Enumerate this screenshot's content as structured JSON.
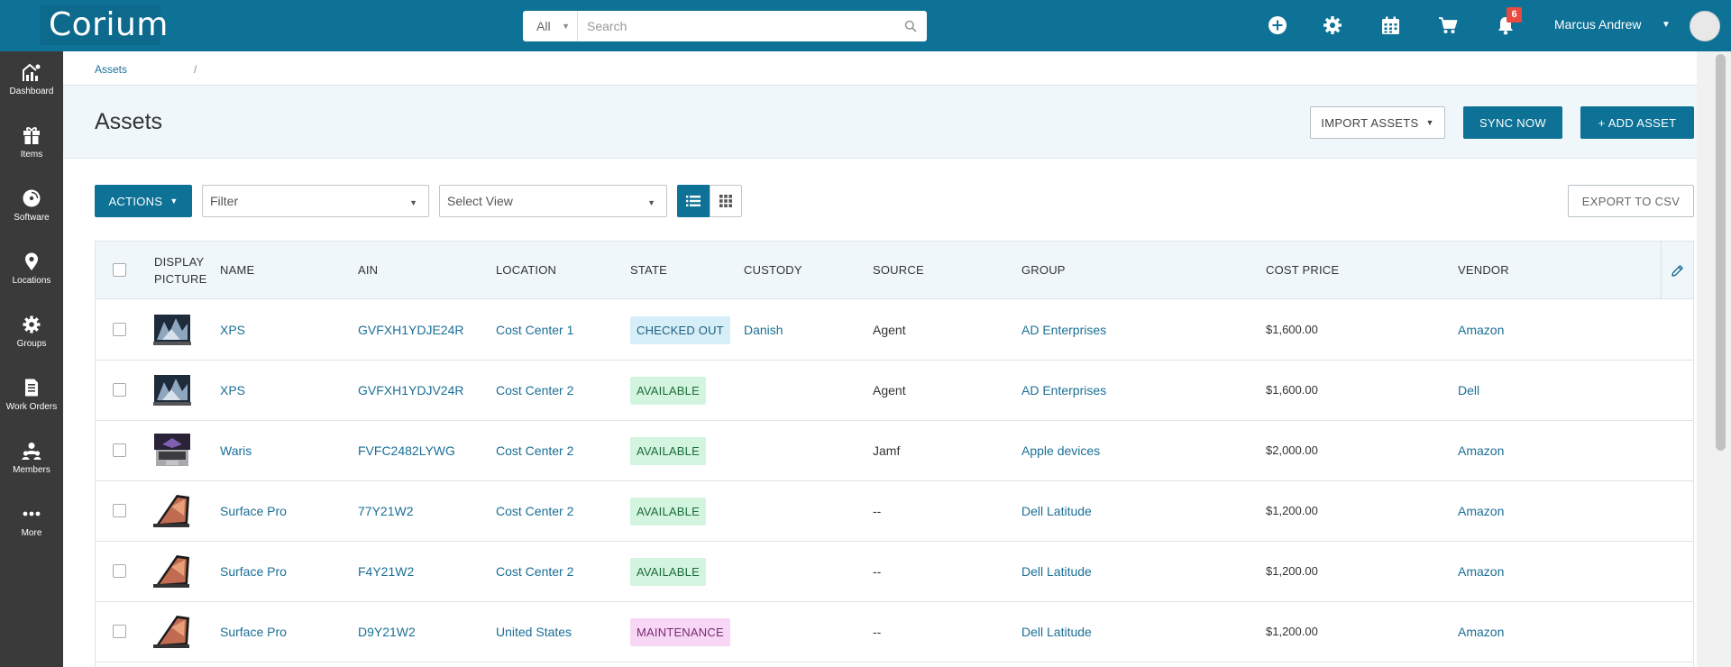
{
  "brand": {
    "logo": "Corium"
  },
  "search": {
    "scope": "All",
    "placeholder": "Search"
  },
  "header": {
    "notification_count": "6",
    "user_name": "Marcus Andrew"
  },
  "sidebar": {
    "items": [
      {
        "label": "Dashboard",
        "icon": "dashboard-icon"
      },
      {
        "label": "Items",
        "icon": "items-icon"
      },
      {
        "label": "Software",
        "icon": "software-icon"
      },
      {
        "label": "Locations",
        "icon": "location-pin-icon"
      },
      {
        "label": "Groups",
        "icon": "groups-icon"
      },
      {
        "label": "Work Orders",
        "icon": "work-orders-icon"
      },
      {
        "label": "Members",
        "icon": "members-icon"
      },
      {
        "label": "More",
        "icon": "more-icon"
      }
    ]
  },
  "breadcrumb": {
    "item": "Assets",
    "sep": "/"
  },
  "page": {
    "title": "Assets",
    "import_label": "IMPORT ASSETS",
    "sync_label": "SYNC NOW",
    "add_label": "+ ADD ASSET"
  },
  "toolbar": {
    "actions_label": "ACTIONS",
    "filter_value": "Filter",
    "view_value": "Select View",
    "export_label": "EXPORT TO CSV"
  },
  "table": {
    "headers": {
      "picture_1": "DISPLAY",
      "picture_2": "PICTURE",
      "name": "NAME",
      "ain": "AIN",
      "location": "LOCATION",
      "state": "STATE",
      "custody": "CUSTODY",
      "source": "SOURCE",
      "group": "GROUP",
      "cost": "COST PRICE",
      "vendor": "VENDOR"
    },
    "rows": [
      {
        "thumb": "laptop",
        "name": "XPS",
        "ain": "GVFXH1YDJE24R",
        "location": "Cost Center 1",
        "state": "CHECKED OUT",
        "state_kind": "out",
        "custody": "Danish",
        "source": "Agent",
        "group": "AD Enterprises",
        "cost": "$1,600.00",
        "vendor": "Amazon"
      },
      {
        "thumb": "laptop",
        "name": "XPS",
        "ain": "GVFXH1YDJV24R",
        "location": "Cost Center 2",
        "state": "AVAILABLE",
        "state_kind": "av",
        "custody": "",
        "source": "Agent",
        "group": "AD Enterprises",
        "cost": "$1,600.00",
        "vendor": "Dell"
      },
      {
        "thumb": "macbook",
        "name": "Waris",
        "ain": "FVFC2482LYWG",
        "location": "Cost Center 2",
        "state": "AVAILABLE",
        "state_kind": "av",
        "custody": "",
        "source": "Jamf",
        "group": "Apple devices",
        "cost": "$2,000.00",
        "vendor": "Amazon"
      },
      {
        "thumb": "surface",
        "name": "Surface Pro",
        "ain": "77Y21W2",
        "location": "Cost Center 2",
        "state": "AVAILABLE",
        "state_kind": "av",
        "custody": "",
        "source": "--",
        "group": "Dell Latitude",
        "cost": "$1,200.00",
        "vendor": "Amazon"
      },
      {
        "thumb": "surface",
        "name": "Surface Pro",
        "ain": "F4Y21W2",
        "location": "Cost Center 2",
        "state": "AVAILABLE",
        "state_kind": "av",
        "custody": "",
        "source": "--",
        "group": "Dell Latitude",
        "cost": "$1,200.00",
        "vendor": "Amazon"
      },
      {
        "thumb": "surface",
        "name": "Surface Pro",
        "ain": "D9Y21W2",
        "location": "United States",
        "state": "MAINTENANCE",
        "state_kind": "mt",
        "custody": "",
        "source": "--",
        "group": "Dell Latitude",
        "cost": "$1,200.00",
        "vendor": "Amazon"
      }
    ]
  }
}
